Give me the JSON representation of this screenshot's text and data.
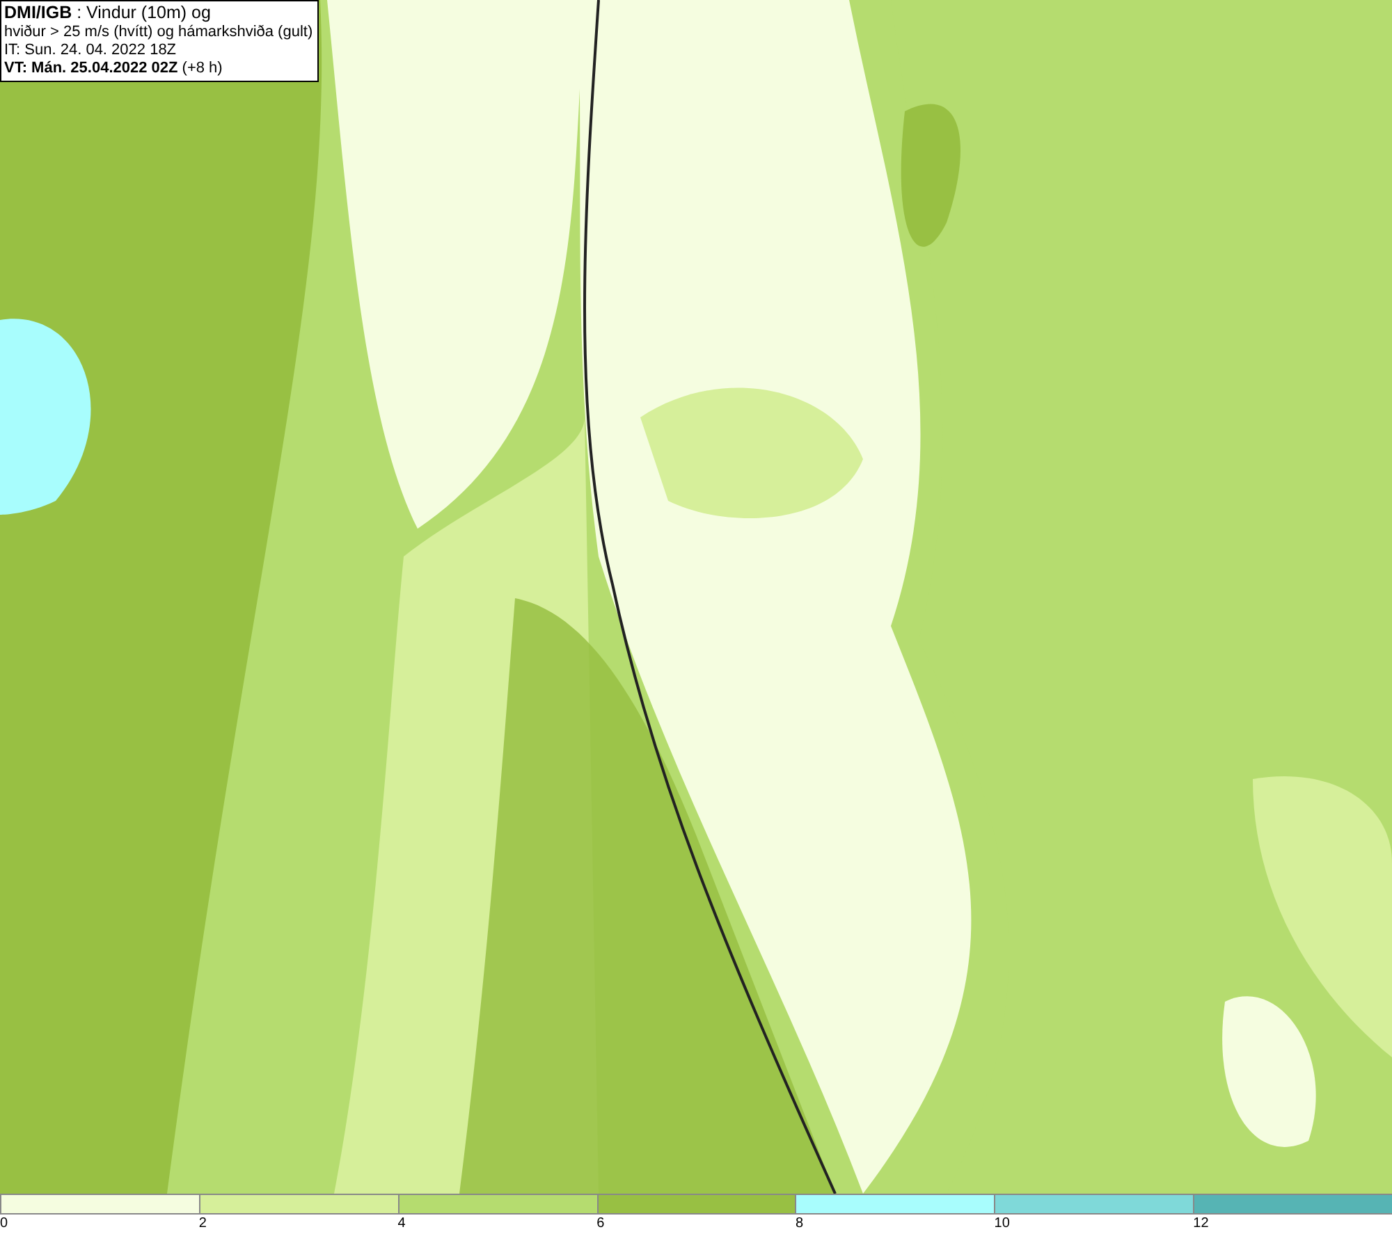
{
  "info_box": {
    "lines": [
      "**DMI/IGB** : Vindur (10m) og",
      "hviður > 25 m/s (hvítt) og hámarkshviða (gult)",
      "IT: Sun. 24. 04. 2022 18Z",
      "**VT: Mán. 25.04.2022 02Z** (+8 h)"
    ]
  },
  "legend": [
    {
      "label": "0",
      "color": "#f5fde0"
    },
    {
      "label": "2",
      "color": "#d6ef9a"
    },
    {
      "label": "4",
      "color": "#b5dc6f"
    },
    {
      "label": "6",
      "color": "#98c043"
    },
    {
      "label": "8",
      "color": "#a8fdfd"
    },
    {
      "label": "10",
      "color": "#7fd9d9"
    },
    {
      "label": "12",
      "color": "#56b4b4"
    }
  ]
}
